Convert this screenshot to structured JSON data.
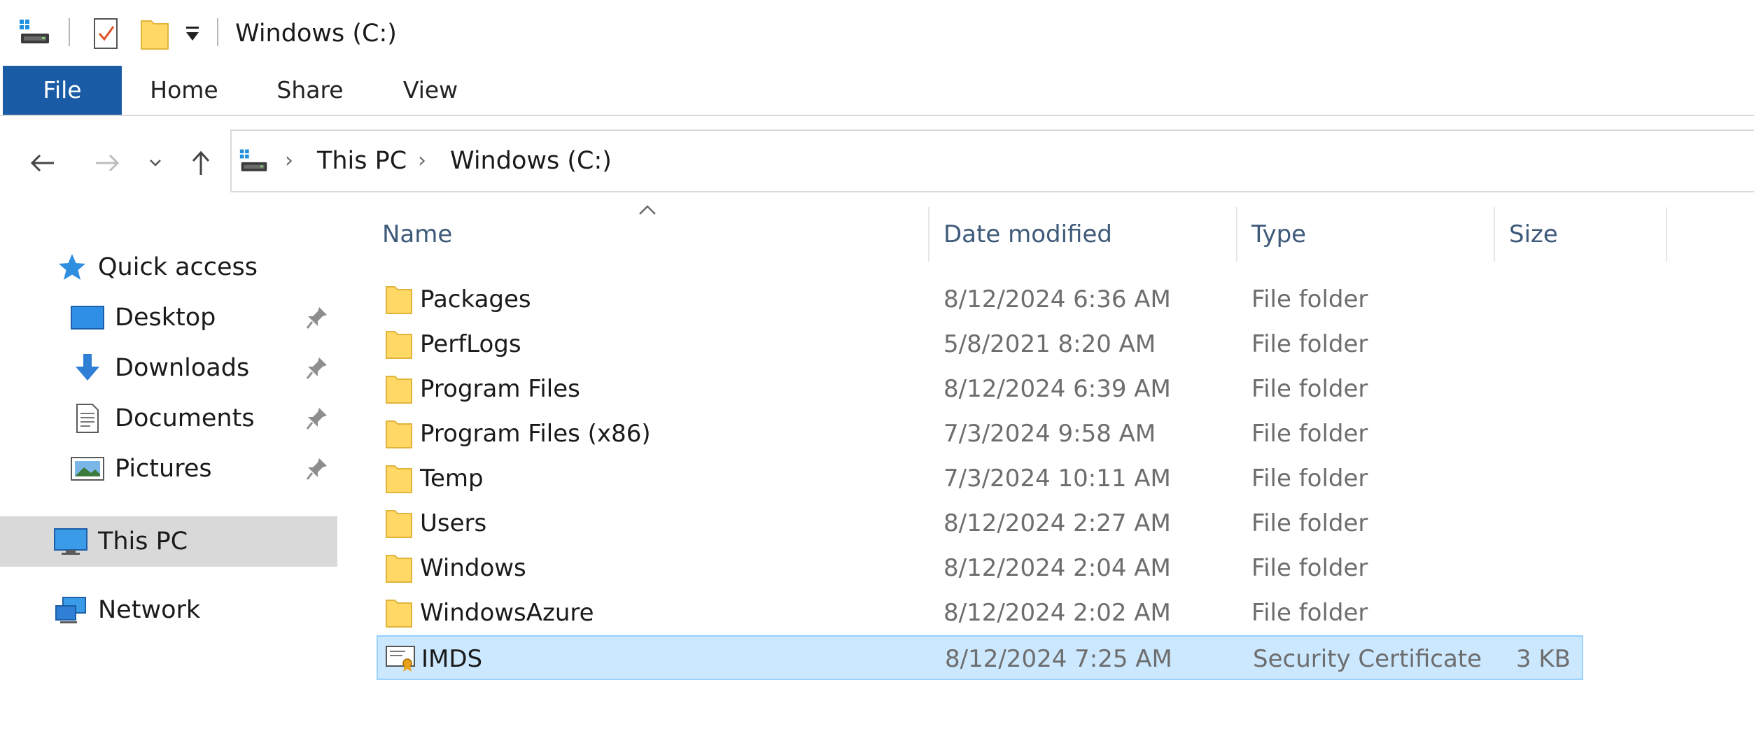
{
  "window": {
    "title": "Windows (C:)"
  },
  "quick_access_toolbar": {
    "icons": [
      "drive-icon",
      "properties-icon",
      "new-folder-icon",
      "customize-dropdown-icon"
    ]
  },
  "ribbon": {
    "tabs": [
      {
        "label": "File",
        "active": true
      },
      {
        "label": "Home"
      },
      {
        "label": "Share"
      },
      {
        "label": "View"
      }
    ]
  },
  "navigation": {
    "back_icon": "back-arrow-icon",
    "forward_icon": "forward-arrow-icon",
    "recent_icon": "chevron-down-icon",
    "up_icon": "up-arrow-icon"
  },
  "address_bar": {
    "breadcrumb": [
      "This PC",
      "Windows (C:)"
    ]
  },
  "sidebar": {
    "quick_access_label": "Quick access",
    "items": [
      {
        "label": "Desktop",
        "icon": "desktop-icon",
        "pinned": true
      },
      {
        "label": "Downloads",
        "icon": "downloads-icon",
        "pinned": true
      },
      {
        "label": "Documents",
        "icon": "documents-icon",
        "pinned": true
      },
      {
        "label": "Pictures",
        "icon": "pictures-icon",
        "pinned": true
      }
    ],
    "this_pc_label": "This PC",
    "network_label": "Network"
  },
  "file_list": {
    "columns": {
      "name": "Name",
      "date_modified": "Date modified",
      "type": "Type",
      "size": "Size"
    },
    "rows": [
      {
        "name": "Packages",
        "date": "8/12/2024 6:36 AM",
        "type": "File folder",
        "size": "",
        "icon": "folder-icon"
      },
      {
        "name": "PerfLogs",
        "date": "5/8/2021 8:20 AM",
        "type": "File folder",
        "size": "",
        "icon": "folder-icon"
      },
      {
        "name": "Program Files",
        "date": "8/12/2024 6:39 AM",
        "type": "File folder",
        "size": "",
        "icon": "folder-icon"
      },
      {
        "name": "Program Files (x86)",
        "date": "7/3/2024 9:58 AM",
        "type": "File folder",
        "size": "",
        "icon": "folder-icon"
      },
      {
        "name": "Temp",
        "date": "7/3/2024 10:11 AM",
        "type": "File folder",
        "size": "",
        "icon": "folder-icon"
      },
      {
        "name": "Users",
        "date": "8/12/2024 2:27 AM",
        "type": "File folder",
        "size": "",
        "icon": "folder-icon"
      },
      {
        "name": "Windows",
        "date": "8/12/2024 2:04 AM",
        "type": "File folder",
        "size": "",
        "icon": "folder-icon"
      },
      {
        "name": "WindowsAzure",
        "date": "8/12/2024 2:02 AM",
        "type": "File folder",
        "size": "",
        "icon": "folder-icon"
      },
      {
        "name": "IMDS",
        "date": "8/12/2024 7:25 AM",
        "type": "Security Certificate",
        "size": "3 KB",
        "icon": "certificate-icon",
        "selected": true
      }
    ]
  },
  "colors": {
    "file_tab": "#1a5ba6",
    "selected_row": "#cce8ff",
    "selected_row_border": "#99d1ff",
    "sidebar_selected": "#d9d9d9",
    "folder_yellow": "#ffd866"
  }
}
